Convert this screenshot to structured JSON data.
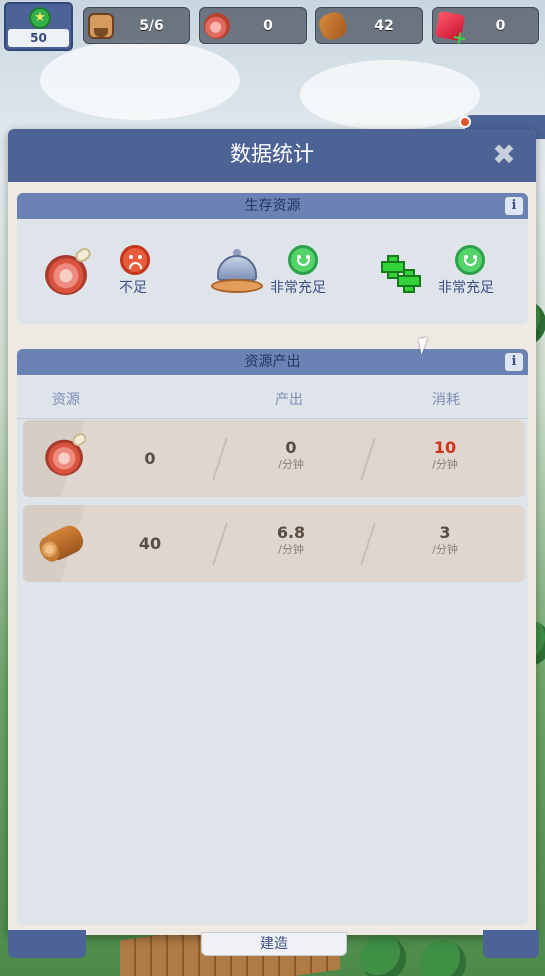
{
  "hud": {
    "level": "50",
    "population": "5/6",
    "meat": "0",
    "wood": "42",
    "gems": "0"
  },
  "modal": {
    "title": "数据统计",
    "close_icon": "close-icon"
  },
  "survival": {
    "title": "生存资源",
    "info_icon": "info-icon",
    "items": [
      {
        "icon": "meat-icon",
        "status_icon": "sad-face-icon",
        "status": "不足"
      },
      {
        "icon": "cloche-icon",
        "status_icon": "happy-face-icon",
        "status": "非常充足"
      },
      {
        "icon": "medical-cross-icon",
        "status_icon": "happy-face-icon",
        "status": "非常充足"
      }
    ]
  },
  "production": {
    "title": "资源产出",
    "info_icon": "info-icon",
    "headers": {
      "resource": "资源",
      "output": "产出",
      "consume": "消耗"
    },
    "rows": [
      {
        "icon": "meat-icon",
        "amount": "0",
        "output": "0",
        "output_unit": "/分钟",
        "consume": "10",
        "consume_unit": "/分钟",
        "consume_color": "#d0321d"
      },
      {
        "icon": "log-icon",
        "amount": "40",
        "output": "6.8",
        "output_unit": "/分钟",
        "consume": "3",
        "consume_unit": "/分钟",
        "consume_color": "#5a4d44"
      }
    ]
  },
  "bottom": {
    "build_label": "建造"
  },
  "colors": {
    "header": "#4d6396",
    "panel_head": "#6b82b4",
    "panel_bg": "#dfe3ea",
    "row_bg": "#ded6cf",
    "warn": "#d0321d",
    "ok": "#54d36b"
  }
}
